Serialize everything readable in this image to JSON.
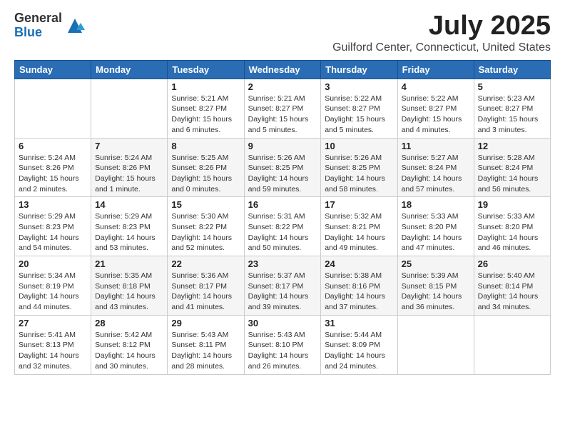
{
  "logo": {
    "general": "General",
    "blue": "Blue"
  },
  "title": "July 2025",
  "location": "Guilford Center, Connecticut, United States",
  "days_of_week": [
    "Sunday",
    "Monday",
    "Tuesday",
    "Wednesday",
    "Thursday",
    "Friday",
    "Saturday"
  ],
  "weeks": [
    [
      {
        "num": "",
        "sunrise": "",
        "sunset": "",
        "daylight": ""
      },
      {
        "num": "",
        "sunrise": "",
        "sunset": "",
        "daylight": ""
      },
      {
        "num": "1",
        "sunrise": "Sunrise: 5:21 AM",
        "sunset": "Sunset: 8:27 PM",
        "daylight": "Daylight: 15 hours and 6 minutes."
      },
      {
        "num": "2",
        "sunrise": "Sunrise: 5:21 AM",
        "sunset": "Sunset: 8:27 PM",
        "daylight": "Daylight: 15 hours and 5 minutes."
      },
      {
        "num": "3",
        "sunrise": "Sunrise: 5:22 AM",
        "sunset": "Sunset: 8:27 PM",
        "daylight": "Daylight: 15 hours and 5 minutes."
      },
      {
        "num": "4",
        "sunrise": "Sunrise: 5:22 AM",
        "sunset": "Sunset: 8:27 PM",
        "daylight": "Daylight: 15 hours and 4 minutes."
      },
      {
        "num": "5",
        "sunrise": "Sunrise: 5:23 AM",
        "sunset": "Sunset: 8:27 PM",
        "daylight": "Daylight: 15 hours and 3 minutes."
      }
    ],
    [
      {
        "num": "6",
        "sunrise": "Sunrise: 5:24 AM",
        "sunset": "Sunset: 8:26 PM",
        "daylight": "Daylight: 15 hours and 2 minutes."
      },
      {
        "num": "7",
        "sunrise": "Sunrise: 5:24 AM",
        "sunset": "Sunset: 8:26 PM",
        "daylight": "Daylight: 15 hours and 1 minute."
      },
      {
        "num": "8",
        "sunrise": "Sunrise: 5:25 AM",
        "sunset": "Sunset: 8:26 PM",
        "daylight": "Daylight: 15 hours and 0 minutes."
      },
      {
        "num": "9",
        "sunrise": "Sunrise: 5:26 AM",
        "sunset": "Sunset: 8:25 PM",
        "daylight": "Daylight: 14 hours and 59 minutes."
      },
      {
        "num": "10",
        "sunrise": "Sunrise: 5:26 AM",
        "sunset": "Sunset: 8:25 PM",
        "daylight": "Daylight: 14 hours and 58 minutes."
      },
      {
        "num": "11",
        "sunrise": "Sunrise: 5:27 AM",
        "sunset": "Sunset: 8:24 PM",
        "daylight": "Daylight: 14 hours and 57 minutes."
      },
      {
        "num": "12",
        "sunrise": "Sunrise: 5:28 AM",
        "sunset": "Sunset: 8:24 PM",
        "daylight": "Daylight: 14 hours and 56 minutes."
      }
    ],
    [
      {
        "num": "13",
        "sunrise": "Sunrise: 5:29 AM",
        "sunset": "Sunset: 8:23 PM",
        "daylight": "Daylight: 14 hours and 54 minutes."
      },
      {
        "num": "14",
        "sunrise": "Sunrise: 5:29 AM",
        "sunset": "Sunset: 8:23 PM",
        "daylight": "Daylight: 14 hours and 53 minutes."
      },
      {
        "num": "15",
        "sunrise": "Sunrise: 5:30 AM",
        "sunset": "Sunset: 8:22 PM",
        "daylight": "Daylight: 14 hours and 52 minutes."
      },
      {
        "num": "16",
        "sunrise": "Sunrise: 5:31 AM",
        "sunset": "Sunset: 8:22 PM",
        "daylight": "Daylight: 14 hours and 50 minutes."
      },
      {
        "num": "17",
        "sunrise": "Sunrise: 5:32 AM",
        "sunset": "Sunset: 8:21 PM",
        "daylight": "Daylight: 14 hours and 49 minutes."
      },
      {
        "num": "18",
        "sunrise": "Sunrise: 5:33 AM",
        "sunset": "Sunset: 8:20 PM",
        "daylight": "Daylight: 14 hours and 47 minutes."
      },
      {
        "num": "19",
        "sunrise": "Sunrise: 5:33 AM",
        "sunset": "Sunset: 8:20 PM",
        "daylight": "Daylight: 14 hours and 46 minutes."
      }
    ],
    [
      {
        "num": "20",
        "sunrise": "Sunrise: 5:34 AM",
        "sunset": "Sunset: 8:19 PM",
        "daylight": "Daylight: 14 hours and 44 minutes."
      },
      {
        "num": "21",
        "sunrise": "Sunrise: 5:35 AM",
        "sunset": "Sunset: 8:18 PM",
        "daylight": "Daylight: 14 hours and 43 minutes."
      },
      {
        "num": "22",
        "sunrise": "Sunrise: 5:36 AM",
        "sunset": "Sunset: 8:17 PM",
        "daylight": "Daylight: 14 hours and 41 minutes."
      },
      {
        "num": "23",
        "sunrise": "Sunrise: 5:37 AM",
        "sunset": "Sunset: 8:17 PM",
        "daylight": "Daylight: 14 hours and 39 minutes."
      },
      {
        "num": "24",
        "sunrise": "Sunrise: 5:38 AM",
        "sunset": "Sunset: 8:16 PM",
        "daylight": "Daylight: 14 hours and 37 minutes."
      },
      {
        "num": "25",
        "sunrise": "Sunrise: 5:39 AM",
        "sunset": "Sunset: 8:15 PM",
        "daylight": "Daylight: 14 hours and 36 minutes."
      },
      {
        "num": "26",
        "sunrise": "Sunrise: 5:40 AM",
        "sunset": "Sunset: 8:14 PM",
        "daylight": "Daylight: 14 hours and 34 minutes."
      }
    ],
    [
      {
        "num": "27",
        "sunrise": "Sunrise: 5:41 AM",
        "sunset": "Sunset: 8:13 PM",
        "daylight": "Daylight: 14 hours and 32 minutes."
      },
      {
        "num": "28",
        "sunrise": "Sunrise: 5:42 AM",
        "sunset": "Sunset: 8:12 PM",
        "daylight": "Daylight: 14 hours and 30 minutes."
      },
      {
        "num": "29",
        "sunrise": "Sunrise: 5:43 AM",
        "sunset": "Sunset: 8:11 PM",
        "daylight": "Daylight: 14 hours and 28 minutes."
      },
      {
        "num": "30",
        "sunrise": "Sunrise: 5:43 AM",
        "sunset": "Sunset: 8:10 PM",
        "daylight": "Daylight: 14 hours and 26 minutes."
      },
      {
        "num": "31",
        "sunrise": "Sunrise: 5:44 AM",
        "sunset": "Sunset: 8:09 PM",
        "daylight": "Daylight: 14 hours and 24 minutes."
      },
      {
        "num": "",
        "sunrise": "",
        "sunset": "",
        "daylight": ""
      },
      {
        "num": "",
        "sunrise": "",
        "sunset": "",
        "daylight": ""
      }
    ]
  ]
}
